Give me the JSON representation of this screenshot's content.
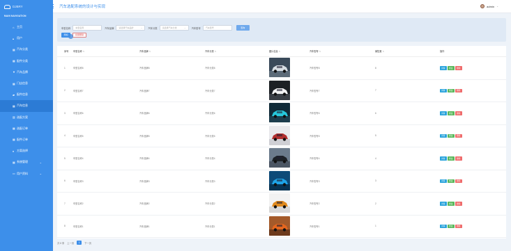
{
  "app": {
    "logo_text": "DJBRY",
    "nav_title": "MAIN NAVIGATION",
    "title": "汽车选配系统的设计与实现"
  },
  "sidebar": {
    "items": [
      {
        "icon": "home-icon",
        "glyph": "⌂",
        "label": "主页",
        "active": false
      },
      {
        "icon": "user-icon",
        "glyph": "▴",
        "label": "用户",
        "active": false
      },
      {
        "icon": "grid-icon",
        "glyph": "▦",
        "label": "汽车分类",
        "active": false
      },
      {
        "icon": "grid-icon",
        "glyph": "▦",
        "label": "配件分类",
        "active": false
      },
      {
        "icon": "funnel-icon",
        "glyph": "▼",
        "label": "汽车品牌",
        "active": false
      },
      {
        "icon": "grid-icon",
        "glyph": "▦",
        "label": "门店信息",
        "active": false
      },
      {
        "icon": "book-icon",
        "glyph": "▰",
        "label": "配件信息",
        "active": false
      },
      {
        "icon": "grid-icon",
        "glyph": "▦",
        "label": "汽车信息",
        "active": true
      },
      {
        "icon": "chart-icon",
        "glyph": "▥",
        "label": "选配方案",
        "active": false
      },
      {
        "icon": "grid-icon",
        "glyph": "▦",
        "label": "选配订单",
        "active": false
      },
      {
        "icon": "grid-icon",
        "glyph": "▦",
        "label": "配件订单",
        "active": false
      },
      {
        "icon": "pin-icon",
        "glyph": "♦",
        "label": "方案选择",
        "active": false
      },
      {
        "icon": "grid-icon",
        "glyph": "▦",
        "label": "系统管理",
        "active": false,
        "expandable": true
      },
      {
        "icon": "monitor-icon",
        "glyph": "▭",
        "label": "用户资料",
        "active": false,
        "expandable": true
      }
    ]
  },
  "header": {
    "user_name": "admin"
  },
  "filters": {
    "name_label": "车型名称",
    "name_placeholder": "车型名称",
    "brand_label": "汽车品牌",
    "brand_placeholder": "请选择汽车品牌",
    "category_label": "汽车分类",
    "category_placeholder": "请选择汽车分类",
    "model_label": "汽车型号",
    "model_placeholder": "汽车型号",
    "query_button": "查询"
  },
  "actions": {
    "add_button": "添加",
    "batch_delete_button": "批量删除"
  },
  "table": {
    "headers": [
      "序号",
      "车型名称",
      "汽车品牌",
      "汽车分类",
      "图片信息",
      "汽车型号",
      "销售数",
      "操作"
    ],
    "rows": [
      {
        "index": "1",
        "name": "车型名称8",
        "brand": "汽车品牌8",
        "category": "汽车分类8",
        "image": "car-image-dark-gray",
        "model": "汽车型号8",
        "sales": "8"
      },
      {
        "index": "2",
        "name": "车型名称7",
        "brand": "汽车品牌7",
        "category": "汽车分类7",
        "image": "car-image-white-sports",
        "model": "汽车型号7",
        "sales": "7"
      },
      {
        "index": "3",
        "name": "车型名称6",
        "brand": "汽车品牌6",
        "category": "汽车分类6",
        "image": "car-image-teal-lights",
        "model": "汽车型号6",
        "sales": "6"
      },
      {
        "index": "4",
        "name": "车型名称5",
        "brand": "汽车品牌5",
        "category": "汽车分类5",
        "image": "car-image-red-suv",
        "model": "汽车型号5",
        "sales": "5"
      },
      {
        "index": "5",
        "name": "车型名称4",
        "brand": "汽车品牌4",
        "category": "汽车分类4",
        "image": "car-image-black-sedan",
        "model": "汽车型号4",
        "sales": "4"
      },
      {
        "index": "6",
        "name": "车型名称3",
        "brand": "汽车品牌3",
        "category": "汽车分类3",
        "image": "car-image-blue-sports",
        "model": "汽车型号3",
        "sales": "3"
      },
      {
        "index": "7",
        "name": "车型名称2",
        "brand": "汽车品牌2",
        "category": "汽车分类2",
        "image": "car-image-orange-coupe",
        "model": "汽车型号2",
        "sales": "2"
      },
      {
        "index": "8",
        "name": "车型名称1",
        "brand": "汽车品牌1",
        "category": "汽车分类1",
        "image": "car-image-orange-road",
        "model": "汽车型号1",
        "sales": "1"
      }
    ],
    "op_labels": {
      "detail": "详情",
      "edit": "修改",
      "delete": "删除"
    }
  },
  "pagination": {
    "total": "共 8 条",
    "prev": "上一页",
    "current_page": "1",
    "next": "下一页"
  },
  "colors": {
    "primary": "#3d8fea",
    "sidebar_active": "#2c7bd5",
    "detail": "#29a3dc",
    "edit": "#5ab85c",
    "delete": "#ef6b6b"
  }
}
